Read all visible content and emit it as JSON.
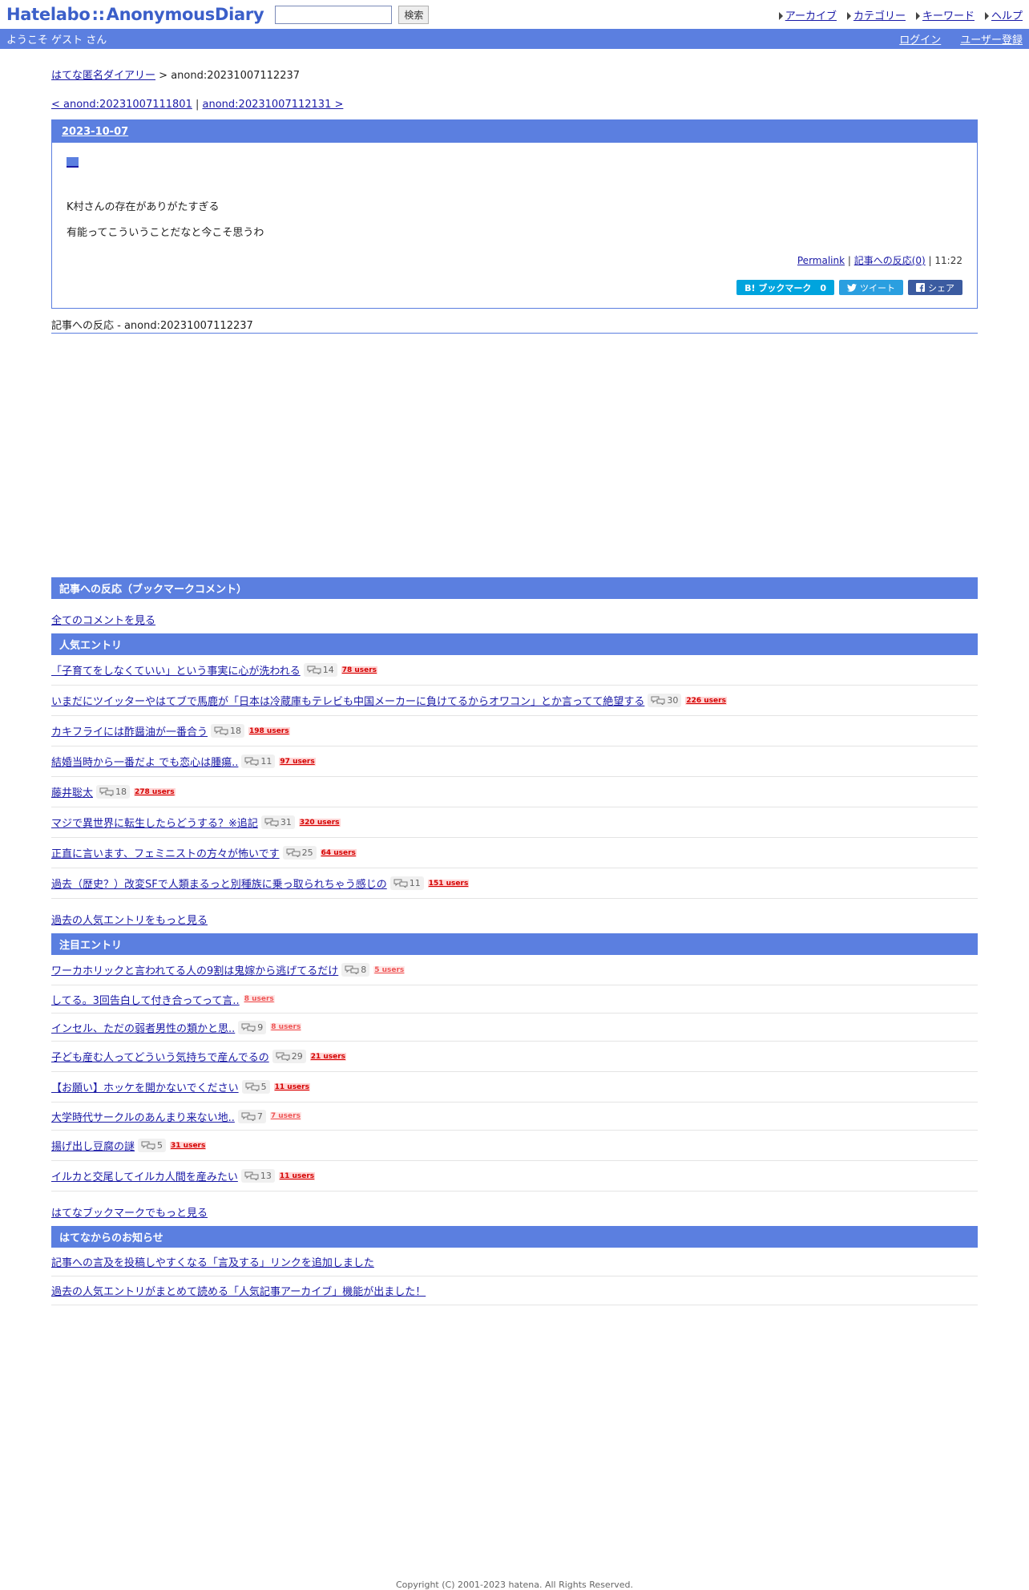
{
  "header": {
    "logo_left": "Hatelabo",
    "logo_sep": "::",
    "logo_right": "AnonymousDiary",
    "search_button": "検索",
    "nav": [
      "アーカイブ",
      "カテゴリー",
      "キーワード",
      "ヘルプ"
    ]
  },
  "bluebar": {
    "welcome": "ようこそ ゲスト さん",
    "login": "ログイン",
    "register": "ユーザー登録"
  },
  "breadcrumb": {
    "home": "はてな匿名ダイアリー",
    "sep": " > ",
    "current": "anond:20231007112237"
  },
  "pager": {
    "prev": "< anond:20231007111801",
    "sep": " | ",
    "next": "anond:20231007112131 >"
  },
  "day": {
    "date": "2023-10-07",
    "lines": [
      "K村さんの存在がありがたすぎる",
      "有能ってこういうことだなと今こそ思うわ"
    ],
    "permalink": "Permalink",
    "reactions": "記事への反応(0)",
    "time": "11:22",
    "share_hb": "B! ブックマーク　0",
    "share_tw": "ツイート",
    "share_fb": "シェア"
  },
  "refer_head": "記事への反応 - anond:20231007112237",
  "bookmark_section": {
    "title": "記事への反応（ブックマークコメント）",
    "all_comments": "全てのコメントを見る"
  },
  "popular": {
    "title": "人気エントリ",
    "items": [
      {
        "title": "「子育てをしなくていい」という事実に心が洗われる",
        "comments": "14",
        "users": "78 users"
      },
      {
        "title": "いまだにツイッターやはてブで馬鹿が「日本は冷蔵庫もテレビも中国メーカーに負けてるからオワコン」とか言ってて絶望する",
        "comments": "30",
        "users": "226 users"
      },
      {
        "title": "カキフライには酢醤油が一番合う",
        "comments": "18",
        "users": "198 users"
      },
      {
        "title": "結婚当時から一番だよ でも恋心は腫瘍..",
        "comments": "11",
        "users": "97 users"
      },
      {
        "title": "藤井聡太",
        "comments": "18",
        "users": "278 users"
      },
      {
        "title": "マジで異世界に転生したらどうする？※追記",
        "comments": "31",
        "users": "320 users"
      },
      {
        "title": "正直に言います、フェミニストの方々が怖いです",
        "comments": "25",
        "users": "64 users"
      },
      {
        "title": "過去（歴史？）改変SFで人類まるっと別種族に乗っ取られちゃう感じの",
        "comments": "11",
        "users": "151 users"
      }
    ],
    "more": "過去の人気エントリをもっと見る"
  },
  "hot": {
    "title": "注目エントリ",
    "items": [
      {
        "title": "ワーカホリックと言われてる人の9割は鬼嫁から逃げてるだけ",
        "comments": "8",
        "users": "5 users",
        "light": true
      },
      {
        "title": "してる。3回告白して付き合ってって言..",
        "comments": "",
        "users": "8 users",
        "light": true
      },
      {
        "title": "インセル、ただの弱者男性の類かと思..",
        "comments": "9",
        "users": "8 users",
        "light": true
      },
      {
        "title": "子ども産む人ってどういう気持ちで産んでるの",
        "comments": "29",
        "users": "21 users",
        "light": false
      },
      {
        "title": "【お願い】ホッケを開かないでください",
        "comments": "5",
        "users": "11 users",
        "light": false
      },
      {
        "title": "大学時代サークルのあんまり来ない地..",
        "comments": "7",
        "users": "7 users",
        "light": true
      },
      {
        "title": "揚げ出し豆腐の謎",
        "comments": "5",
        "users": "31 users",
        "light": false
      },
      {
        "title": "イルカと交尾してイルカ人間を産みたい",
        "comments": "13",
        "users": "11 users",
        "light": false
      }
    ],
    "more": "はてなブックマークでもっと見る"
  },
  "news": {
    "title": "はてなからのお知らせ",
    "items": [
      "記事への言及を投稿しやすくなる「言及する」リンクを追加しました",
      "過去の人気エントリがまとめて読める「人気記事アーカイブ」機能が出ました！"
    ]
  },
  "copyright": "Copyright (C) 2001-2023 hatena. All Rights Reserved."
}
